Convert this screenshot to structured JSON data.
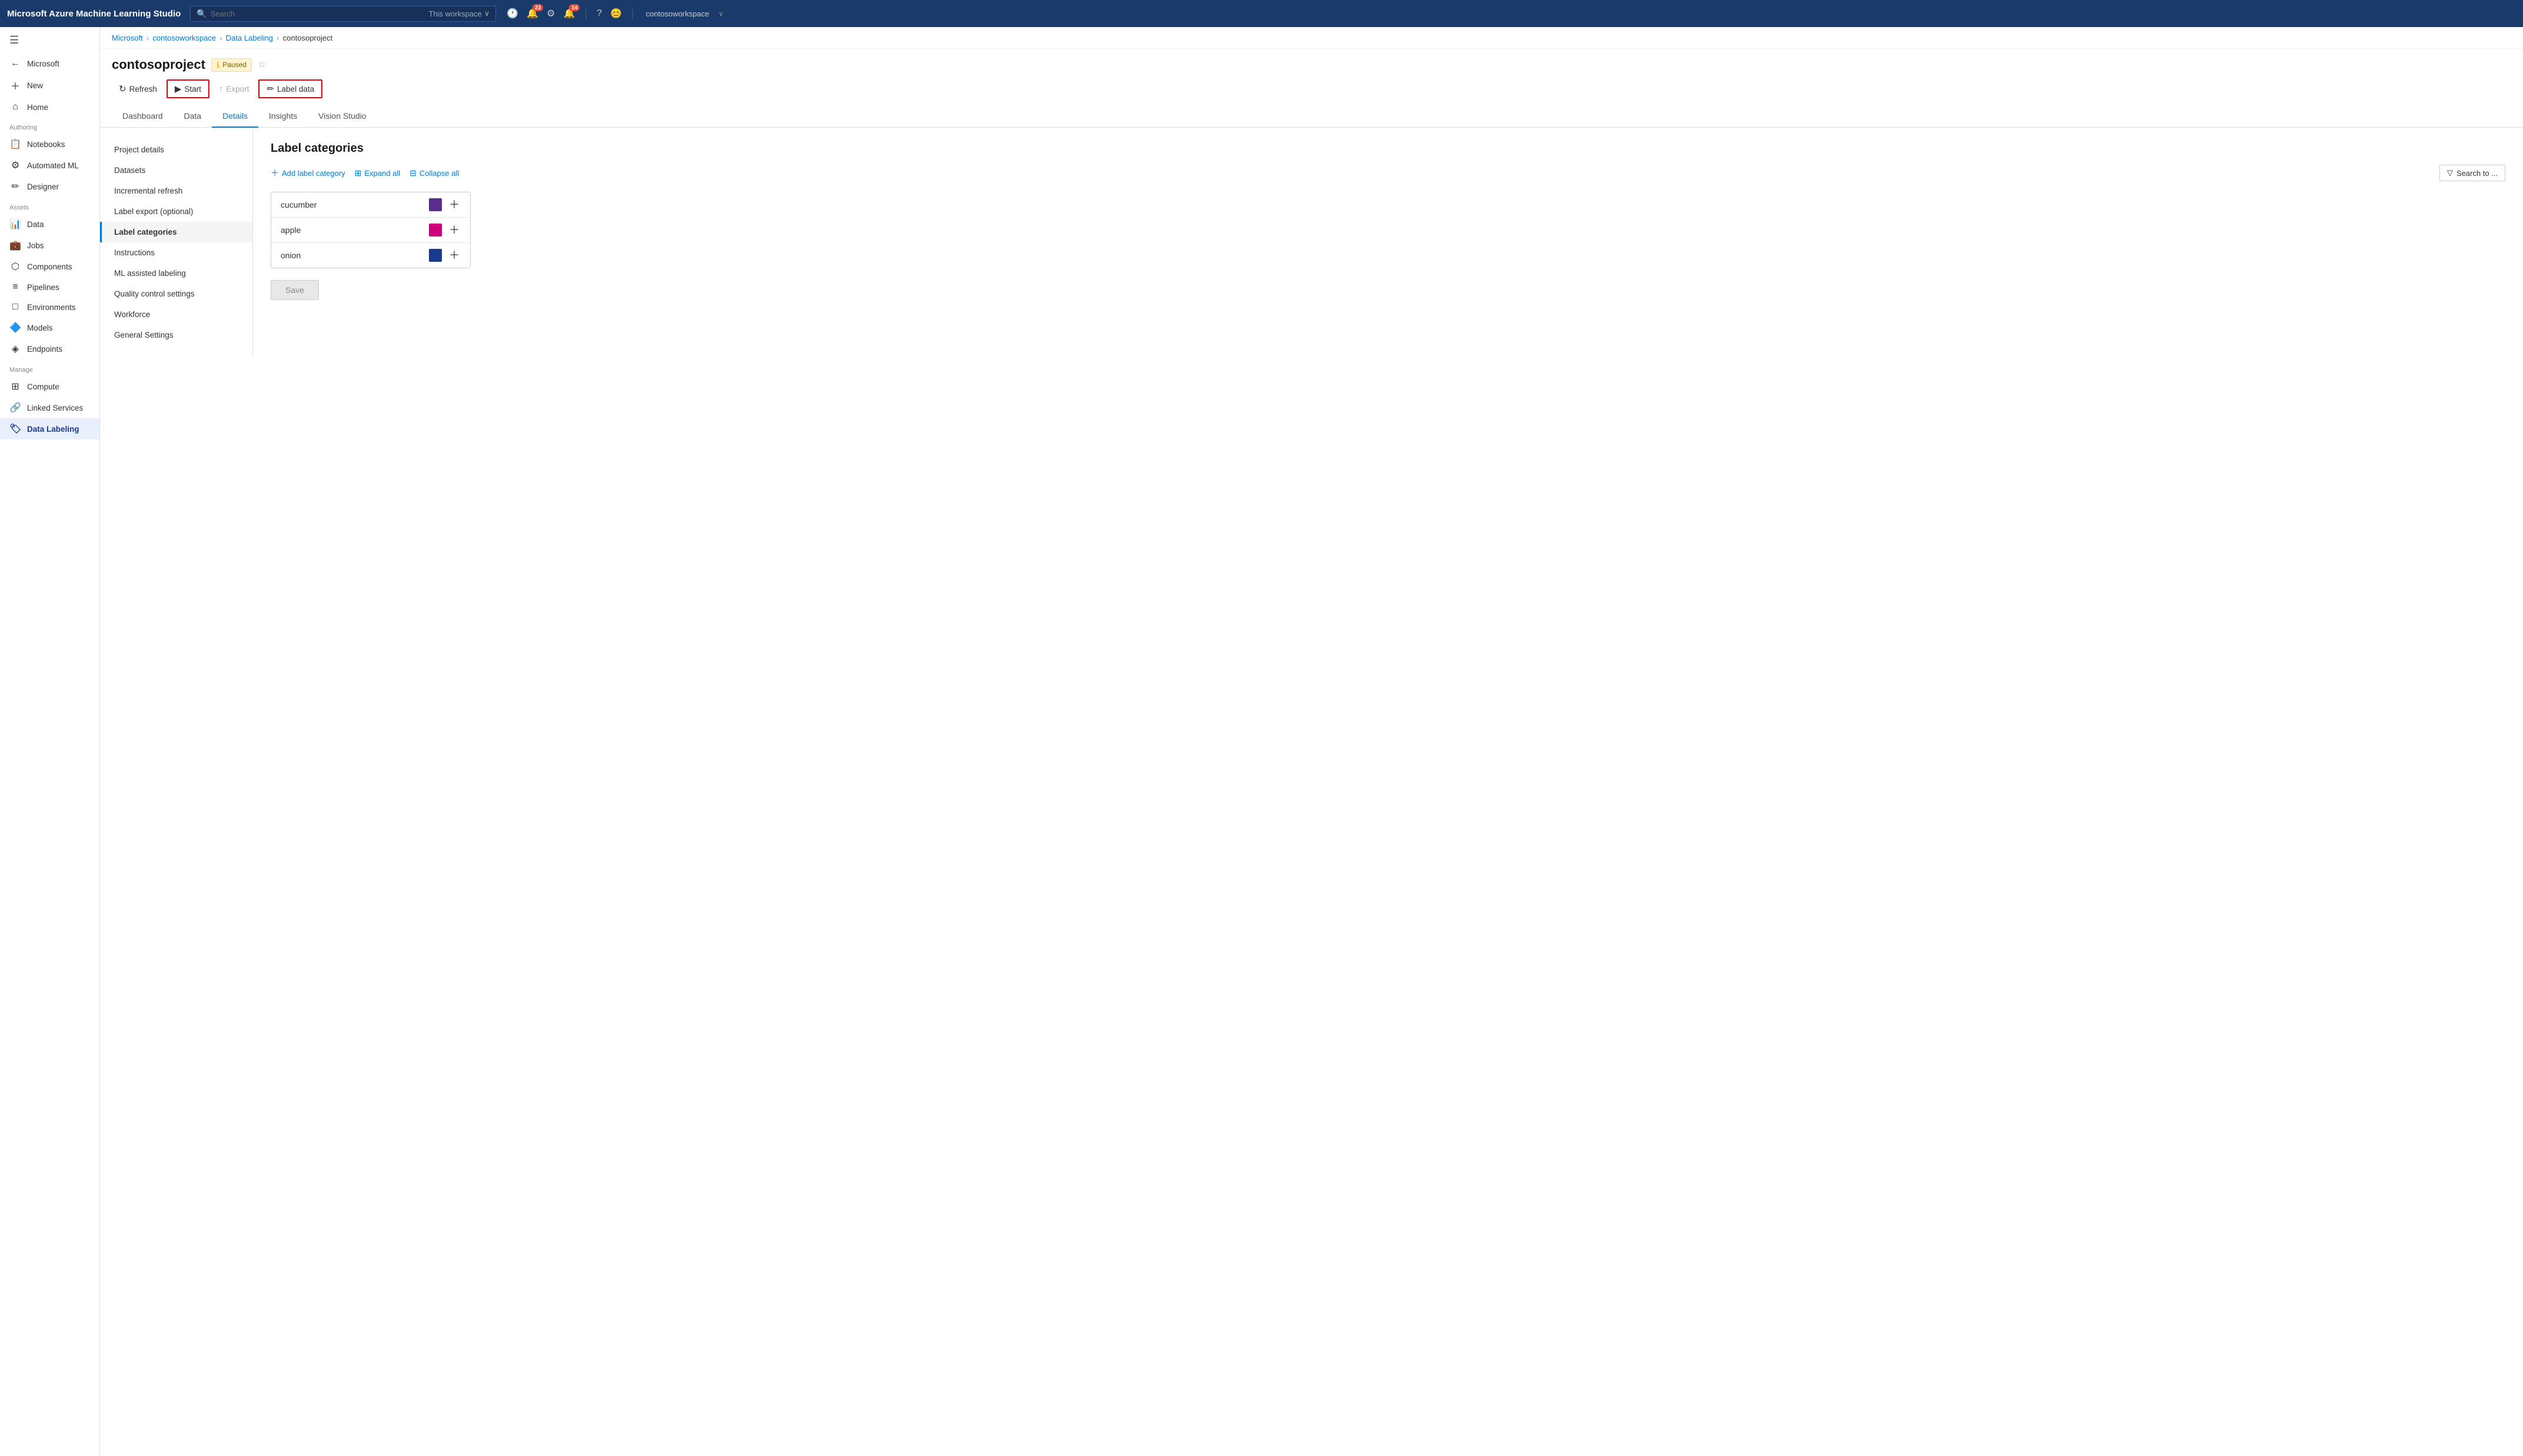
{
  "topNav": {
    "brand": "Microsoft Azure Machine Learning Studio",
    "searchPlaceholder": "Search",
    "workspaceLabel": "This workspace",
    "notifications1Count": "23",
    "notifications2Count": "14",
    "username": "contosoworkspace"
  },
  "breadcrumb": {
    "items": [
      "Microsoft",
      "contosoworkspace",
      "Data Labeling",
      "contosoproject"
    ]
  },
  "pageHeader": {
    "title": "contosoproject",
    "status": "Paused",
    "starLabel": "☆"
  },
  "toolbar": {
    "refreshLabel": "Refresh",
    "startLabel": "Start",
    "exportLabel": "Export",
    "labelDataLabel": "Label data"
  },
  "tabs": {
    "items": [
      "Dashboard",
      "Data",
      "Details",
      "Insights",
      "Vision Studio"
    ],
    "activeIndex": 2
  },
  "leftPanel": {
    "items": [
      "Project details",
      "Datasets",
      "Incremental refresh",
      "Label export (optional)",
      "Label categories",
      "Instructions",
      "ML assisted labeling",
      "Quality control settings",
      "Workforce",
      "General Settings"
    ],
    "activeIndex": 4
  },
  "labelCategories": {
    "sectionTitle": "Label categories",
    "addLabel": "Add label category",
    "expandAll": "Expand all",
    "collapseAll": "Collapse all",
    "searchPlaceholder": "Search to ...",
    "items": [
      {
        "name": "cucumber",
        "color": "#5b2d8e"
      },
      {
        "name": "apple",
        "color": "#cc007a"
      },
      {
        "name": "onion",
        "color": "#1a3a8f"
      }
    ]
  },
  "sidebar": {
    "authoring": "Authoring",
    "assets": "Assets",
    "manage": "Manage",
    "items": [
      {
        "icon": "⊕",
        "label": "New",
        "section": "top"
      },
      {
        "icon": "⌂",
        "label": "Home",
        "section": "top"
      },
      {
        "icon": "📓",
        "label": "Notebooks",
        "section": "authoring"
      },
      {
        "icon": "⚙",
        "label": "Automated ML",
        "section": "authoring"
      },
      {
        "icon": "✏",
        "label": "Designer",
        "section": "authoring"
      },
      {
        "icon": "📊",
        "label": "Data",
        "section": "assets"
      },
      {
        "icon": "💼",
        "label": "Jobs",
        "section": "assets"
      },
      {
        "icon": "⬡",
        "label": "Components",
        "section": "assets"
      },
      {
        "icon": "≡",
        "label": "Pipelines",
        "section": "assets"
      },
      {
        "icon": "□",
        "label": "Environments",
        "section": "assets"
      },
      {
        "icon": "🔷",
        "label": "Models",
        "section": "assets"
      },
      {
        "icon": "◈",
        "label": "Endpoints",
        "section": "assets"
      },
      {
        "icon": "⊞",
        "label": "Compute",
        "section": "manage"
      },
      {
        "icon": "🔗",
        "label": "Linked Services",
        "section": "manage"
      },
      {
        "icon": "🏷",
        "label": "Data Labeling",
        "section": "manage",
        "active": true
      }
    ]
  },
  "saveBtn": "Save"
}
